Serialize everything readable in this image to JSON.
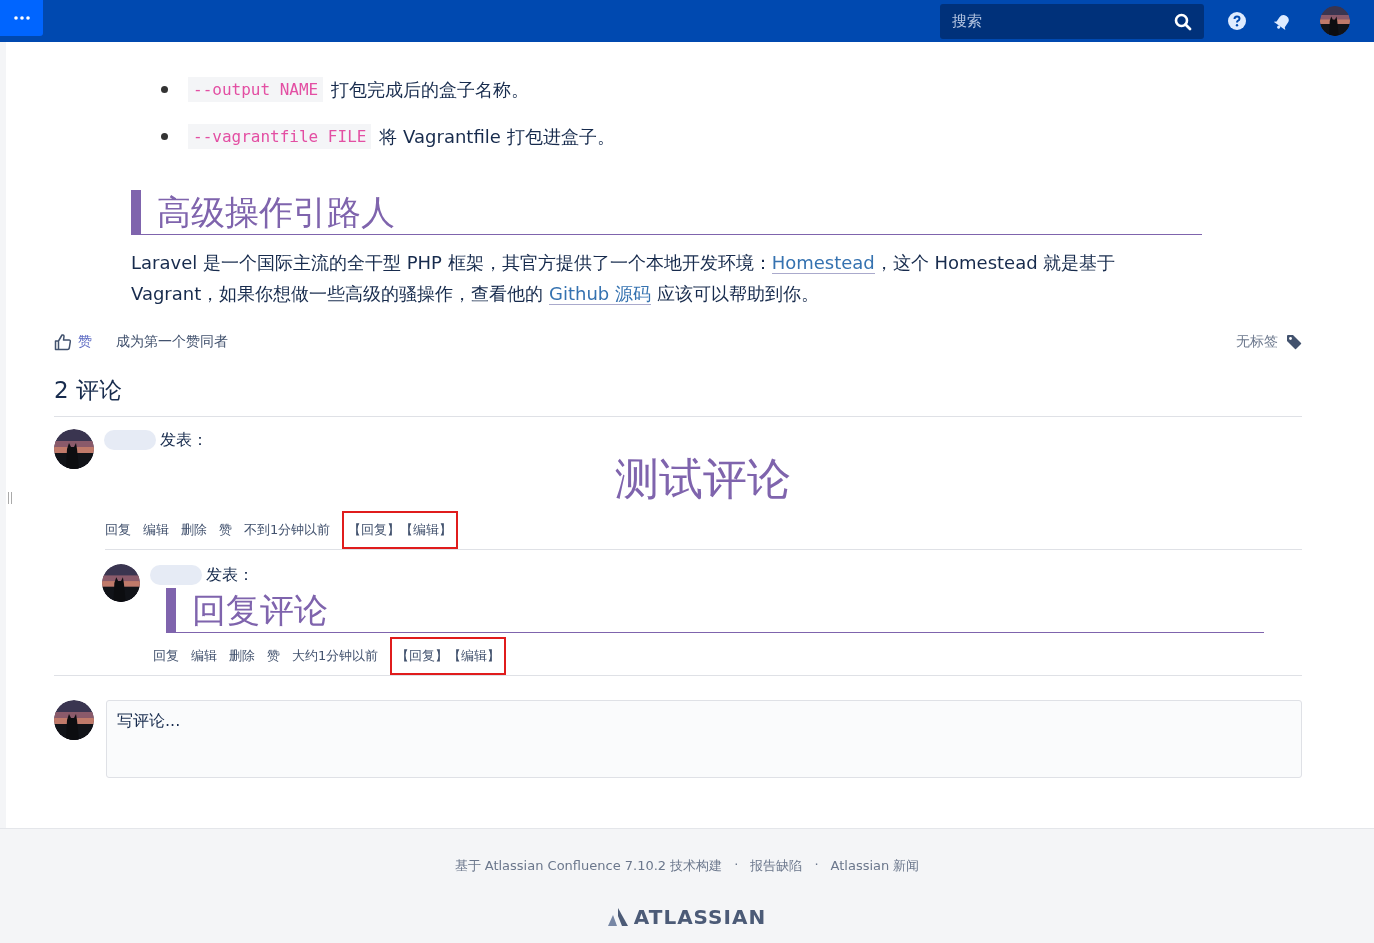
{
  "header": {
    "search": {
      "placeholder": "搜索"
    }
  },
  "options": [
    {
      "code": "--output NAME",
      "text": "打包完成后的盒子名称。"
    },
    {
      "code": "--vagrantfile FILE",
      "text": "将 Vagrantfile 打包进盒子。"
    }
  ],
  "section": {
    "heading": "高级操作引路人",
    "paragraph": [
      {
        "kind": "text",
        "text": "Laravel 是一个国际主流的全干型 PHP 框架，其官方提供了一个本地开发环境："
      },
      {
        "kind": "link",
        "text": "Homestead"
      },
      {
        "kind": "text",
        "text": "，这个 Homestead 就是基于 Vagrant，如果你想做一些高级的骚操作，查看他的 "
      },
      {
        "kind": "link",
        "text": "Github 源码"
      },
      {
        "kind": "text",
        "text": " 应该可以帮助到你。"
      }
    ]
  },
  "likes": {
    "label": "赞",
    "summary": "成为第一个赞同者"
  },
  "labels": {
    "text": "无标签"
  },
  "comments": {
    "title": "2 评论",
    "items": [
      {
        "verb": "发表：",
        "body": "测试评论",
        "actions": [
          "回复",
          "编辑",
          "删除",
          "赞"
        ],
        "time": "不到1分钟以前",
        "extras": [
          "【回复】",
          "【编辑】"
        ],
        "children": [
          {
            "verb": "发表：",
            "body": "回复评论",
            "actions": [
              "回复",
              "编辑",
              "删除",
              "赞"
            ],
            "time": "大约1分钟以前",
            "extras": [
              "【回复】",
              "【编辑】"
            ]
          }
        ]
      }
    ]
  },
  "composer": {
    "placeholder": "写评论..."
  },
  "footer": {
    "links": [
      "基于 Atlassian Confluence 7.10.2 技术构建",
      "报告缺陷",
      "Atlassian 新闻"
    ],
    "separators": [
      "·",
      "·"
    ],
    "logo": "ATLASSIAN"
  }
}
